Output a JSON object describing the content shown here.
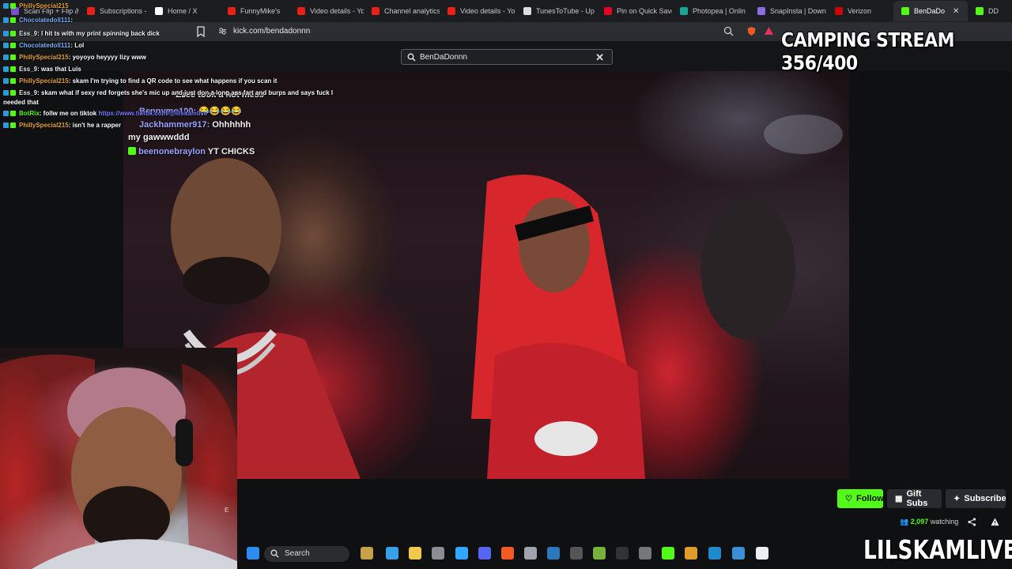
{
  "browser": {
    "tabs": [
      {
        "label": "Scan Flip + Flip ∂",
        "color": "#7a4fc9"
      },
      {
        "label": "Subscriptions - Yo",
        "color": "#e62117"
      },
      {
        "label": "Home / X",
        "color": "#ffffff"
      },
      {
        "label": "FunnyMike's",
        "color": "#e62117"
      },
      {
        "label": "Video details - Yo",
        "color": "#e62117"
      },
      {
        "label": "Channel analytics",
        "color": "#e62117"
      },
      {
        "label": "Video details - Yo",
        "color": "#e62117"
      },
      {
        "label": "TunesToTube - Up",
        "color": "#dddddd"
      },
      {
        "label": "Pin on Quick Save",
        "color": "#e60023"
      },
      {
        "label": "Photopea | Onlin",
        "color": "#18a497"
      },
      {
        "label": "SnapInsta | Down",
        "color": "#8a6ee0"
      },
      {
        "label": "Verizon",
        "color": "#cd040b"
      },
      {
        "label": "BenDaDo",
        "color": "#53fc18",
        "active": true
      },
      {
        "label": "DD",
        "color": "#53fc18"
      }
    ],
    "url": "kick.com/bendadonnn"
  },
  "search": {
    "value": "BenDaDonnn"
  },
  "overlay_title": "CAMPING STREAM 356/400",
  "side_chat": [
    {
      "user": "PhillySpecial215",
      "user_color": "#e8a33a",
      "msg": ""
    },
    {
      "user": "Chocolatedoll111",
      "user_color": "#7fb6ff",
      "msg": ":"
    },
    {
      "user": "Ess_9",
      "user_color": "#e8e8e8",
      "msg": ": I hit ts with my print spinning back dick"
    },
    {
      "user": "Chocolatedoll111",
      "user_color": "#7fb6ff",
      "msg": ": Lol"
    },
    {
      "user": "PhillySpecial215",
      "user_color": "#e8a33a",
      "msg": ": yoyoyo heyyyy lizy www"
    },
    {
      "user": "Ess_9",
      "user_color": "#e8e8e8",
      "msg": ": was that Luis"
    },
    {
      "user": "PhillySpecial215",
      "user_color": "#e8a33a",
      "msg": ": skam I'm trying to find a QR code to see what happens if you scan it"
    },
    {
      "user": "Ess_9",
      "user_color": "#e8e8e8",
      "msg": ": skam what if sexy red forgets she's mic up and just don a long ass fart and burps and says fuck I"
    },
    {
      "user": "",
      "user_color": "#e8e8e8",
      "msg": "needed that"
    },
    {
      "user": "BotRix",
      "user_color": "#53fc18",
      "msg": ": follw me on tiktok ",
      "link": "https://www.tiktok.com/@lilskamlive"
    },
    {
      "user": "PhillySpecial215",
      "user_color": "#e8a33a",
      "msg": ": isn't he a rapper"
    }
  ],
  "stream_chat": [
    {
      "user": "",
      "msg": "Ezee took a hot mess"
    },
    {
      "user": "Bennymo100:",
      "msg": "😂😂😂😂"
    },
    {
      "user": "Jackhammer917:",
      "msg": "Ohhhhhh"
    },
    {
      "user": "",
      "msg": "my gawwwddd"
    },
    {
      "user": "beenonebraylon",
      "msg": "YT CHICKS"
    }
  ],
  "channel_actions": {
    "follow": "Follow",
    "gift": "Gift Subs",
    "subscribe": "Subscribe",
    "viewers": "2,097",
    "viewers_suffix": "watching"
  },
  "taskbar": {
    "search_label": "Search"
  },
  "watermark": "LILSKAMLIVE",
  "kick_green": "#53fc18"
}
